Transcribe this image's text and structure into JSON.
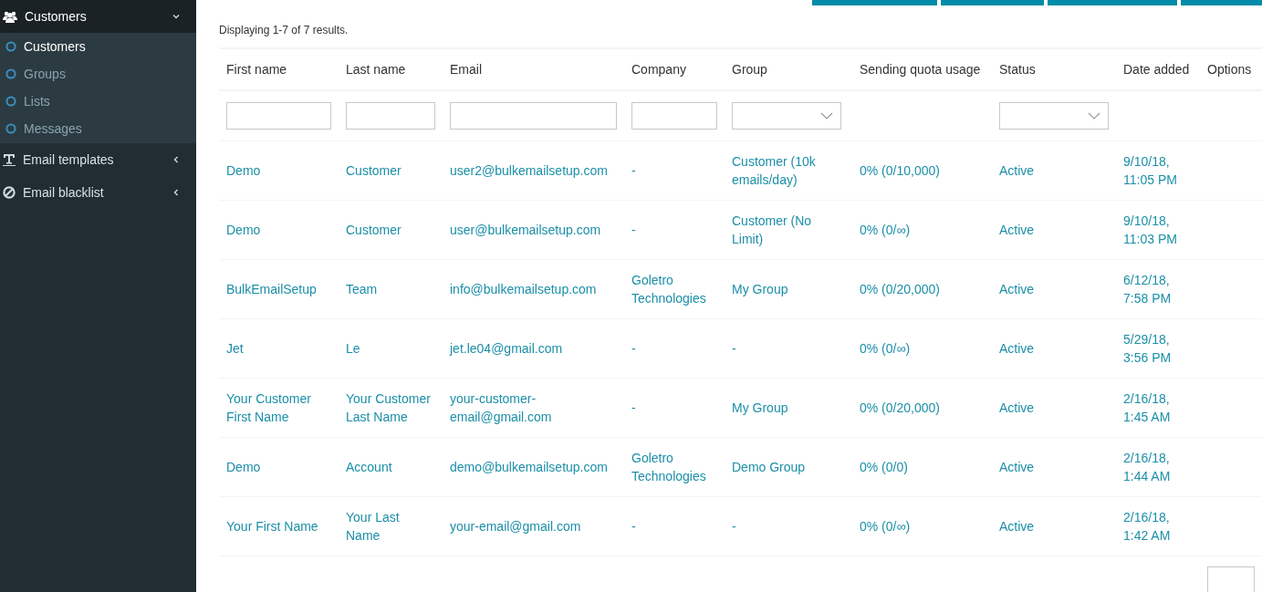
{
  "sidebar": {
    "items": [
      {
        "label": "Customers",
        "expanded": true,
        "children": [
          {
            "label": "Customers",
            "selected": true
          },
          {
            "label": "Groups",
            "selected": false
          },
          {
            "label": "Lists",
            "selected": false
          },
          {
            "label": "Messages",
            "selected": false
          }
        ]
      },
      {
        "label": "Email templates",
        "expanded": false
      },
      {
        "label": "Email blacklist",
        "expanded": false
      }
    ]
  },
  "summary": "Displaying 1-7 of 7 results.",
  "table": {
    "columns": [
      {
        "label": "First name",
        "kind": "text"
      },
      {
        "label": "Last name",
        "kind": "text"
      },
      {
        "label": "Email",
        "kind": "text"
      },
      {
        "label": "Company",
        "kind": "text"
      },
      {
        "label": "Group",
        "kind": "select"
      },
      {
        "label": "Sending quota usage",
        "kind": "plain"
      },
      {
        "label": "Status",
        "kind": "select"
      },
      {
        "label": "Date added",
        "kind": "plain"
      },
      {
        "label": "Options",
        "kind": "plain"
      }
    ],
    "rows": [
      [
        "Demo",
        "Customer",
        "user2@bulkemailsetup.com",
        "-",
        "Customer (10k emails/day)",
        "0% (0/10,000)",
        "Active",
        "9/10/18, 11:05 PM"
      ],
      [
        "Demo",
        "Customer",
        "user@bulkemailsetup.com",
        "-",
        "Customer (No Limit)",
        "0% (0/∞)",
        "Active",
        "9/10/18, 11:03 PM"
      ],
      [
        "BulkEmailSetup",
        "Team",
        "info@bulkemailsetup.com",
        "Goletro Technologies",
        "My Group",
        "0% (0/20,000)",
        "Active",
        "6/12/18, 7:58 PM"
      ],
      [
        "Jet",
        "Le",
        "jet.le04@gmail.com",
        "-",
        "-",
        "0% (0/∞)",
        "Active",
        "5/29/18, 3:56 PM"
      ],
      [
        "Your Customer First Name",
        "Your Customer Last Name",
        "your-customer-email@gmail.com",
        "-",
        "My Group",
        "0% (0/20,000)",
        "Active",
        "2/16/18, 1:45 AM"
      ],
      [
        "Demo",
        "Account",
        "demo@bulkemailsetup.com",
        "Goletro Technologies",
        "Demo Group",
        "0% (0/0)",
        "Active",
        "2/16/18, 1:44 AM"
      ],
      [
        "Your First Name",
        "Your Last Name",
        "your-email@gmail.com",
        "-",
        "-",
        "0% (0/∞)",
        "Active",
        "2/16/18, 1:42 AM"
      ]
    ]
  }
}
